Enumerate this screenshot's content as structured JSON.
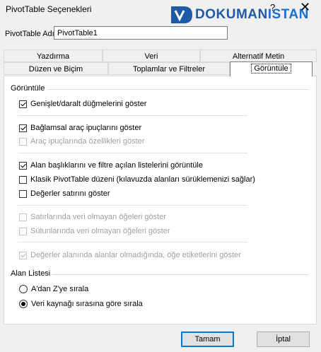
{
  "window": {
    "title": "PivotTable Seçenekleri",
    "help_label": "?",
    "close_label": "✕"
  },
  "watermark": {
    "part1": "DOKUMAN",
    "part2": "ISTAN"
  },
  "name_field": {
    "label": "PivotTable Adı:",
    "value": "PivotTable1"
  },
  "tabs": {
    "row1": [
      "Yazdırma",
      "Veri",
      "Alternatif Metin"
    ],
    "row2": [
      "Düzen ve Biçim",
      "Toplamlar ve Filtreler",
      "Görüntüle"
    ],
    "active": "Görüntüle"
  },
  "display": {
    "group_label": "Görüntüle",
    "options": [
      {
        "label": "Genişlet/daralt düğmelerini göster",
        "checked": true,
        "enabled": true
      },
      {
        "label": "Bağlamsal araç ipuçlarını göster",
        "checked": true,
        "enabled": true
      },
      {
        "label": "Araç ipuçlarında özellikleri göster",
        "checked": false,
        "enabled": false
      },
      {
        "label": "Alan başlıklarını ve filtre açılan listelerini görüntüle",
        "checked": true,
        "enabled": true
      },
      {
        "label": "Klasik PivotTable düzeni (kılavuzda alanları sürüklemenizi sağlar)",
        "checked": false,
        "enabled": true
      },
      {
        "label": "Değerler satırını göster",
        "checked": false,
        "enabled": true
      },
      {
        "label": "Satırlarında veri olmayan öğeleri göster",
        "checked": false,
        "enabled": false
      },
      {
        "label": "Sütunlarında veri olmayan öğeleri göster",
        "checked": false,
        "enabled": false
      },
      {
        "label": "Değerler alanında alanlar olmadığında, öğe etiketlerini göster",
        "checked": true,
        "enabled": false
      }
    ]
  },
  "field_list": {
    "group_label": "Alan Listesi",
    "options": [
      {
        "label": "A'dan Z'ye sırala",
        "selected": false
      },
      {
        "label": "Veri kaynağı sırasına göre sırala",
        "selected": true
      }
    ]
  },
  "buttons": {
    "ok": "Tamam",
    "cancel": "İptal"
  },
  "colors": {
    "accent": "#0078d7",
    "logo_dark": "#1e5aa8",
    "logo_light": "#1c6fc9"
  }
}
